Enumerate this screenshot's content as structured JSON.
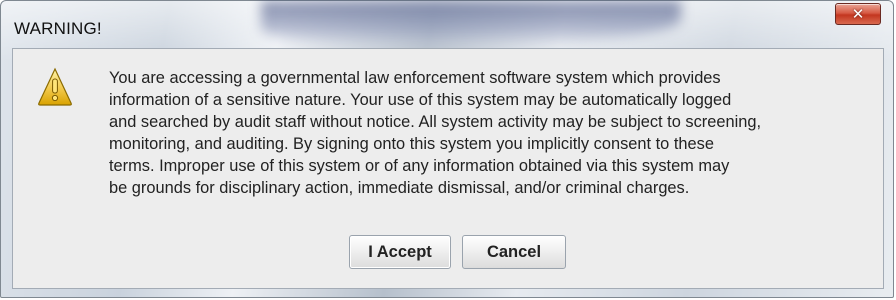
{
  "window": {
    "title": "WARNING!",
    "close_glyph": "✕"
  },
  "dialog": {
    "icon": "warning-icon",
    "message": "You are accessing a governmental law enforcement software system which provides\ninformation of a sensitive nature.  Your use of this system may be automatically logged\nand searched by audit staff without notice.  All system activity may be subject to screening,\nmonitoring, and auditing.  By signing onto this system you implicitly consent to these\nterms.  Improper use of this system or of any information obtained via this system may\nbe grounds for disciplinary action, immediate dismissal, and/or criminal charges.",
    "accept_label": "I Accept",
    "cancel_label": "Cancel"
  },
  "colors": {
    "close_button": "#c3361f",
    "warning_icon": "#e6b800"
  }
}
